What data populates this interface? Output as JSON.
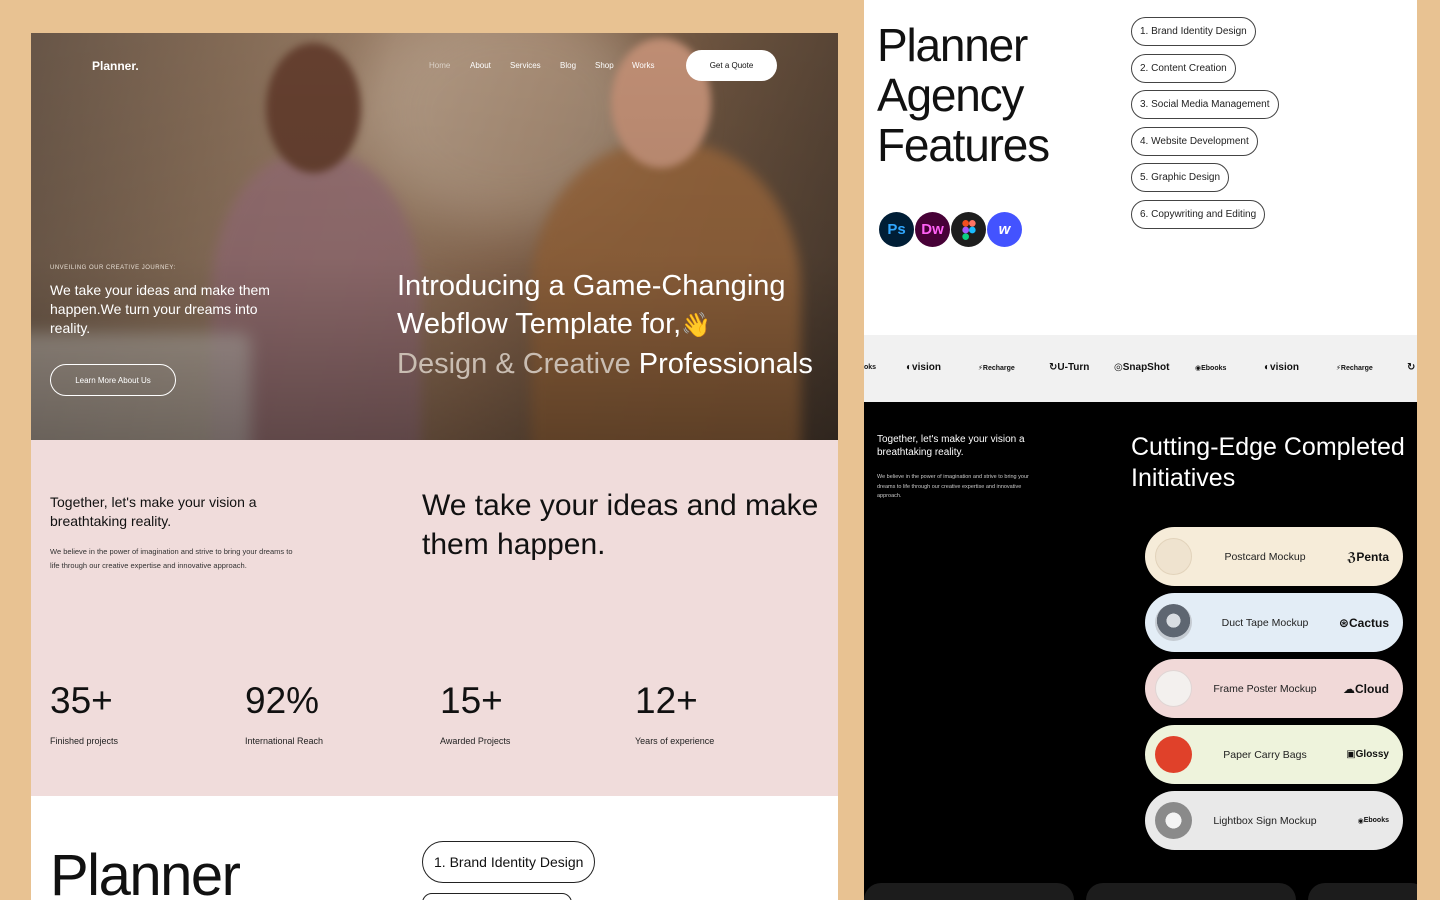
{
  "left": {
    "nav": {
      "logo": "Planner.",
      "links": [
        "Home",
        "About",
        "Services",
        "Blog",
        "Shop",
        "Works"
      ],
      "cta": "Get a Quote"
    },
    "hero": {
      "kicker": "UNVEILING OUR CREATIVE JOURNEY:",
      "lead": "We take your ideas and make them happen.We turn your dreams into reality.",
      "button": "Learn More About Us",
      "title_line1": "Introducing a Game-Changing",
      "title_line2": "Webflow Template for,",
      "emoji": "👋",
      "title_muted": "Design & Creative",
      "title_end": "Professionals"
    },
    "intro": {
      "lead": "Together, let's make your vision a breathtaking reality.",
      "small": "We believe in the power of imagination and strive to bring your dreams to life through our creative expertise and innovative approach.",
      "big": "We take your ideas and make them happen."
    },
    "stats": [
      {
        "value": "35+",
        "label": "Finished projects"
      },
      {
        "value": "92%",
        "label": "International Reach"
      },
      {
        "value": "15+",
        "label": "Awarded Projects"
      },
      {
        "value": "12+",
        "label": "Years of experience"
      }
    ],
    "bottom": {
      "title": "Planner",
      "pill": "1. Brand Identity Design"
    }
  },
  "right": {
    "features": {
      "title_lines": [
        "Planner",
        "Agency",
        "Features"
      ],
      "tools": [
        {
          "name": "photoshop-icon",
          "label": "Ps",
          "bg": "#001e36",
          "fg": "#31a8ff"
        },
        {
          "name": "dreamweaver-icon",
          "label": "Dw",
          "bg": "#470137",
          "fg": "#ff61f6"
        },
        {
          "name": "figma-icon",
          "label": "",
          "bg": "#1e1e1e",
          "fg": "#ffffff"
        },
        {
          "name": "webflow-icon",
          "label": "w",
          "bg": "#4353ff",
          "fg": "#ffffff"
        }
      ],
      "services": [
        "1. Brand Identity Design",
        "2. Content Creation",
        "3. Social Media Management",
        "4. Website Development",
        "5. Graphic Design",
        "6. Copywriting and Editing"
      ]
    },
    "brands": [
      "oks",
      "vision",
      "Recharge",
      "U-Turn",
      "SnapShot",
      "Ebooks",
      "vision",
      "Recharge"
    ],
    "initiatives": {
      "lead": "Together, let's make your vision a breathtaking reality.",
      "small": "We believe in the power of imagination and strive to bring your dreams to life through our creative expertise and innovative approach.",
      "title": "Cutting-Edge Completed Initiatives",
      "projects": [
        {
          "name": "Postcard Mockup",
          "brand": "Penta",
          "bg": "#f6ecd9",
          "thumb": "#efe3cf"
        },
        {
          "name": "Duct Tape Mockup",
          "brand": "Cactus",
          "bg": "#e3edf6",
          "thumb": "#8e9aa6"
        },
        {
          "name": "Frame Poster Mockup",
          "brand": "Cloud",
          "bg": "#f1d9d8",
          "thumb": "#f3f0ee"
        },
        {
          "name": "Paper Carry Bags",
          "brand": "Glossy",
          "bg": "#eef3dc",
          "thumb": "#e0412a"
        },
        {
          "name": "Lightbox Sign Mockup",
          "brand": "Ebooks",
          "bg": "#e9e9e9",
          "thumb": "#9a9a9a"
        }
      ]
    }
  }
}
